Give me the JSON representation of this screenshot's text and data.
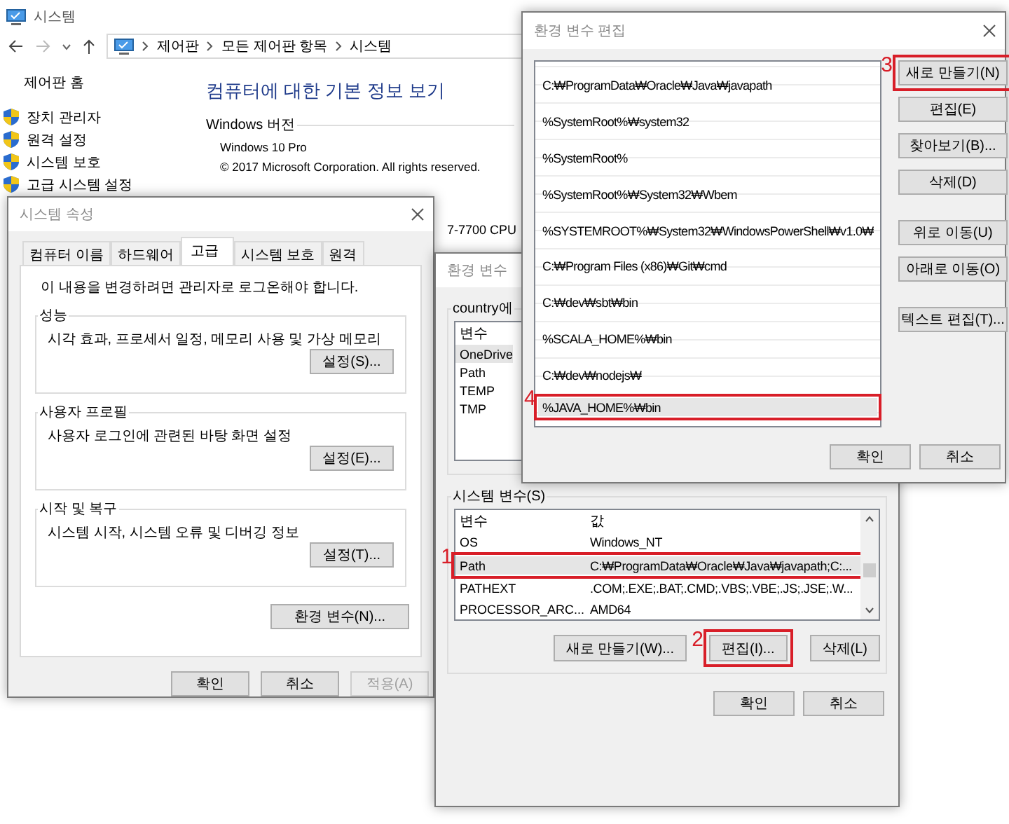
{
  "system_window": {
    "title": "시스템",
    "breadcrumb": [
      "제어판",
      "모든 제어판 항목",
      "시스템"
    ],
    "control_panel_home": "제어판 홈",
    "sidebar_links": [
      "장치 관리자",
      "원격 설정",
      "시스템 보호",
      "고급 시스템 설정"
    ],
    "heading": "컴퓨터에 대한 기본 정보 보기",
    "windows_edition": {
      "title": "Windows 버전",
      "edition": "Windows 10 Pro",
      "copyright": "© 2017 Microsoft Corporation. All rights reserved."
    },
    "processor": "7-7700 CPU"
  },
  "system_properties": {
    "title": "시스템 속성",
    "tabs": [
      {
        "label": "컴퓨터 이름",
        "selected": false
      },
      {
        "label": "하드웨어",
        "selected": false
      },
      {
        "label": "고급",
        "selected": true
      },
      {
        "label": "시스템 보호",
        "selected": false
      },
      {
        "label": "원격",
        "selected": false
      }
    ],
    "notice": "이 내용을 변경하려면 관리자로 로그온해야 합니다.",
    "groups": [
      {
        "title": "성능",
        "description": "시각 효과, 프로세서 일정, 메모리 사용 및 가상 메모리",
        "button": "설정(S)..."
      },
      {
        "title": "사용자 프로필",
        "description": "사용자 로그인에 관련된 바탕 화면 설정",
        "button": "설정(E)..."
      },
      {
        "title": "시작 및 복구",
        "description": "시스템 시작, 시스템 오류 및 디버깅 정보",
        "button": "설정(T)..."
      }
    ],
    "environment_button": "환경 변수(N)...",
    "buttons": [
      {
        "label": "확인",
        "disabled": false
      },
      {
        "label": "취소",
        "disabled": false
      },
      {
        "label": "적용(A)",
        "disabled": true
      }
    ]
  },
  "environment_variables": {
    "title": "환경 변수",
    "user_variables": {
      "title": "country에",
      "columns": [
        "변수"
      ],
      "rows": [
        {
          "name": "OneDrive",
          "selected": true
        },
        {
          "name": "Path",
          "selected": false
        },
        {
          "name": "TEMP",
          "selected": false
        },
        {
          "name": "TMP",
          "selected": false
        }
      ]
    },
    "system_variables": {
      "title": "시스템 변수(S)",
      "columns": [
        "변수",
        "값"
      ],
      "rows": [
        {
          "name": "OS",
          "value": "Windows_NT",
          "selected": false
        },
        {
          "name": "Path",
          "value": "C:₩ProgramData₩Oracle₩Java₩javapath;C:...",
          "selected": true,
          "step": "1"
        },
        {
          "name": "PATHEXT",
          "value": ".COM;.EXE;.BAT;.CMD;.VBS;.VBE;.JS;.JSE;.W...",
          "selected": false
        },
        {
          "name": "PROCESSOR_ARC...",
          "value": "AMD64",
          "selected": false
        }
      ],
      "buttons": [
        {
          "label": "새로 만들기(W)..."
        },
        {
          "label": "편집(I)...",
          "step": "2"
        },
        {
          "label": "삭제(L)"
        }
      ]
    },
    "buttons": [
      "확인",
      "취소"
    ]
  },
  "edit_variable": {
    "title": "환경 변수 편집",
    "entries": [
      {
        "text": "C:₩ProgramData₩Oracle₩Java₩javapath",
        "selected": false
      },
      {
        "text": "%SystemRoot%₩system32",
        "selected": false
      },
      {
        "text": "%SystemRoot%",
        "selected": false
      },
      {
        "text": "%SystemRoot%₩System32₩Wbem",
        "selected": false
      },
      {
        "text": "%SYSTEMROOT%₩System32₩WindowsPowerShell₩v1.0₩",
        "selected": false
      },
      {
        "text": "C:₩Program Files (x86)₩Git₩cmd",
        "selected": false
      },
      {
        "text": "C:₩dev₩sbt₩bin",
        "selected": false
      },
      {
        "text": "%SCALA_HOME%₩bin",
        "selected": false
      },
      {
        "text": "C:₩dev₩nodejs₩",
        "selected": false
      },
      {
        "text": "%JAVA_HOME%₩bin",
        "selected": true,
        "step": "4"
      }
    ],
    "button_groups": [
      [
        {
          "label": "새로 만들기(N)",
          "step": "3"
        },
        {
          "label": "편집(E)"
        },
        {
          "label": "찾아보기(B)..."
        },
        {
          "label": "삭제(D)"
        }
      ],
      [
        {
          "label": "위로 이동(U)"
        },
        {
          "label": "아래로 이동(O)"
        }
      ],
      [
        {
          "label": "텍스트 편집(T)..."
        }
      ]
    ],
    "buttons": [
      "확인",
      "취소"
    ]
  }
}
